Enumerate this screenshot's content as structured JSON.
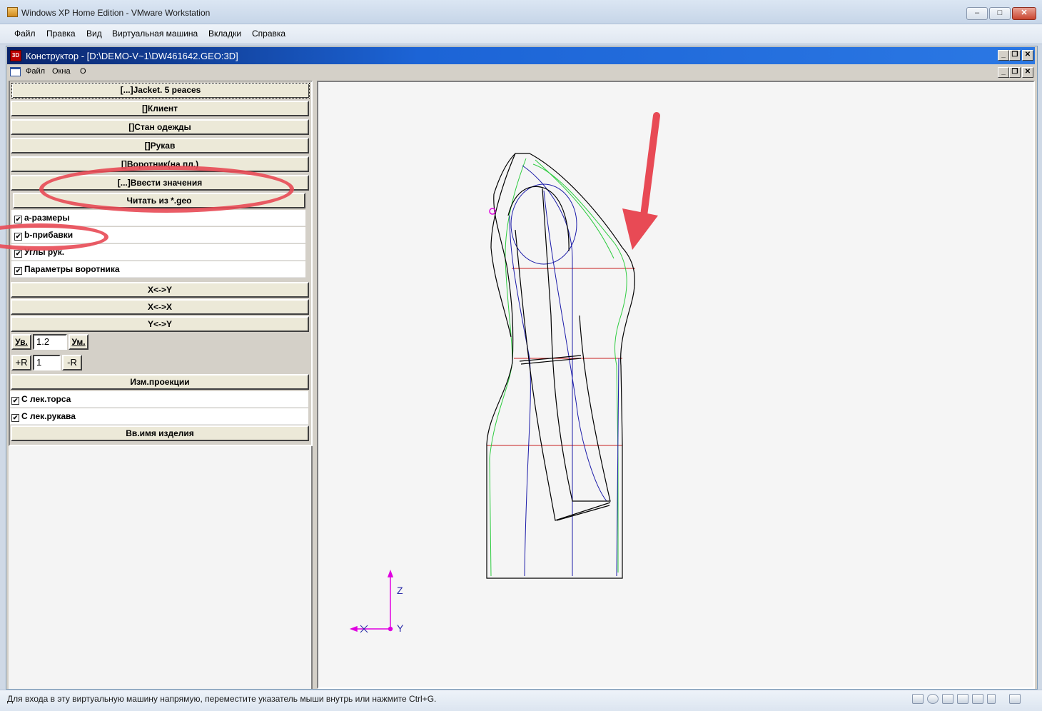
{
  "vm_window": {
    "title": "Windows XP Home Edition - VMware Workstation",
    "controls": {
      "minimize": "–",
      "maximize": "□",
      "close": "✕"
    },
    "menu": [
      "Файл",
      "Правка",
      "Вид",
      "Виртуальная машина",
      "Вкладки",
      "Справка"
    ]
  },
  "app_window": {
    "icon_label": "3D",
    "title": "Конструктор - [D:\\DEMO-V~1\\DW461642.GEO:3D]",
    "controls": {
      "minimize": "_",
      "restore": "❐",
      "close": "✕"
    },
    "menu": [
      "Файл",
      "Окна",
      "О"
    ]
  },
  "left_panel": {
    "header_button": "[...]Jacket. 5 peaces",
    "section_buttons": [
      "[]Клиент",
      "[]Стан одежды",
      "[]Рукав",
      "[]Воротник(на пл.)",
      "[...]Ввести значения"
    ],
    "read_button": "Читать из *.geo",
    "checks": [
      {
        "label": "a-размеры",
        "checked": true
      },
      {
        "label": "b-прибавки",
        "checked": true
      },
      {
        "label": "Углы рук.",
        "checked": true
      },
      {
        "label": "Параметры воротника",
        "checked": true
      }
    ],
    "swap_buttons": [
      "X<->Y",
      "X<->X",
      "Y<->Y"
    ],
    "zoom": {
      "increase_label": "Ув.",
      "value": "1.2",
      "decrease_label": "Ум."
    },
    "radius": {
      "plus_label": "+R",
      "value": "1",
      "minus_label": "-R"
    },
    "projection_button": "Изм.проекции",
    "view_checks": [
      {
        "label": "С лек.торса",
        "checked": true
      },
      {
        "label": "С лек.рукава",
        "checked": true
      }
    ],
    "name_button": "Вв.имя изделия"
  },
  "canvas": {
    "axis_labels": {
      "z": "Z",
      "y": "Y",
      "x": "X"
    },
    "colors": {
      "outline": "#000000",
      "blue": "#1a1aa8",
      "green": "#2ecc40",
      "red": "#c81e1e",
      "magenta": "#e000e0",
      "annotation": "#e84a55"
    }
  },
  "status_bar": {
    "text": "Для входа в эту виртуальную машину напрямую, переместите указатель мыши внутрь или нажмите Ctrl+G."
  }
}
